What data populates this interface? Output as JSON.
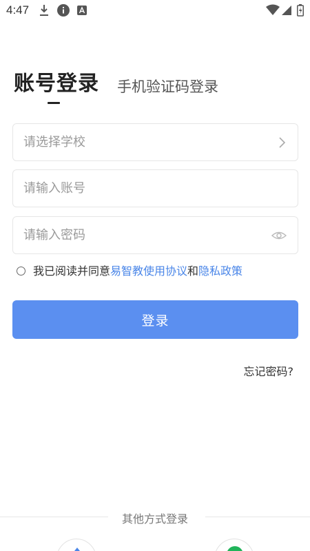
{
  "status_bar": {
    "time": "4:47",
    "icons": [
      "download-icon",
      "info-icon",
      "app-a-icon",
      "wifi-icon",
      "signal-icon",
      "battery-icon"
    ]
  },
  "tabs": {
    "account_login": "账号登录",
    "sms_login": "手机验证码登录"
  },
  "form": {
    "school_placeholder": "请选择学校",
    "account_placeholder": "请输入账号",
    "password_placeholder": "请输入密码"
  },
  "agreement": {
    "prefix": "我已阅读并同意",
    "terms_link": "易智教使用协议",
    "and": "和",
    "privacy_link": "隐私政策"
  },
  "login_button": "登录",
  "forgot_password": "忘记密码?",
  "other_login": {
    "label": "其他方式登录"
  },
  "colors": {
    "accent": "#5b8ff0",
    "link": "#4a86e8",
    "green": "#20b45a"
  }
}
